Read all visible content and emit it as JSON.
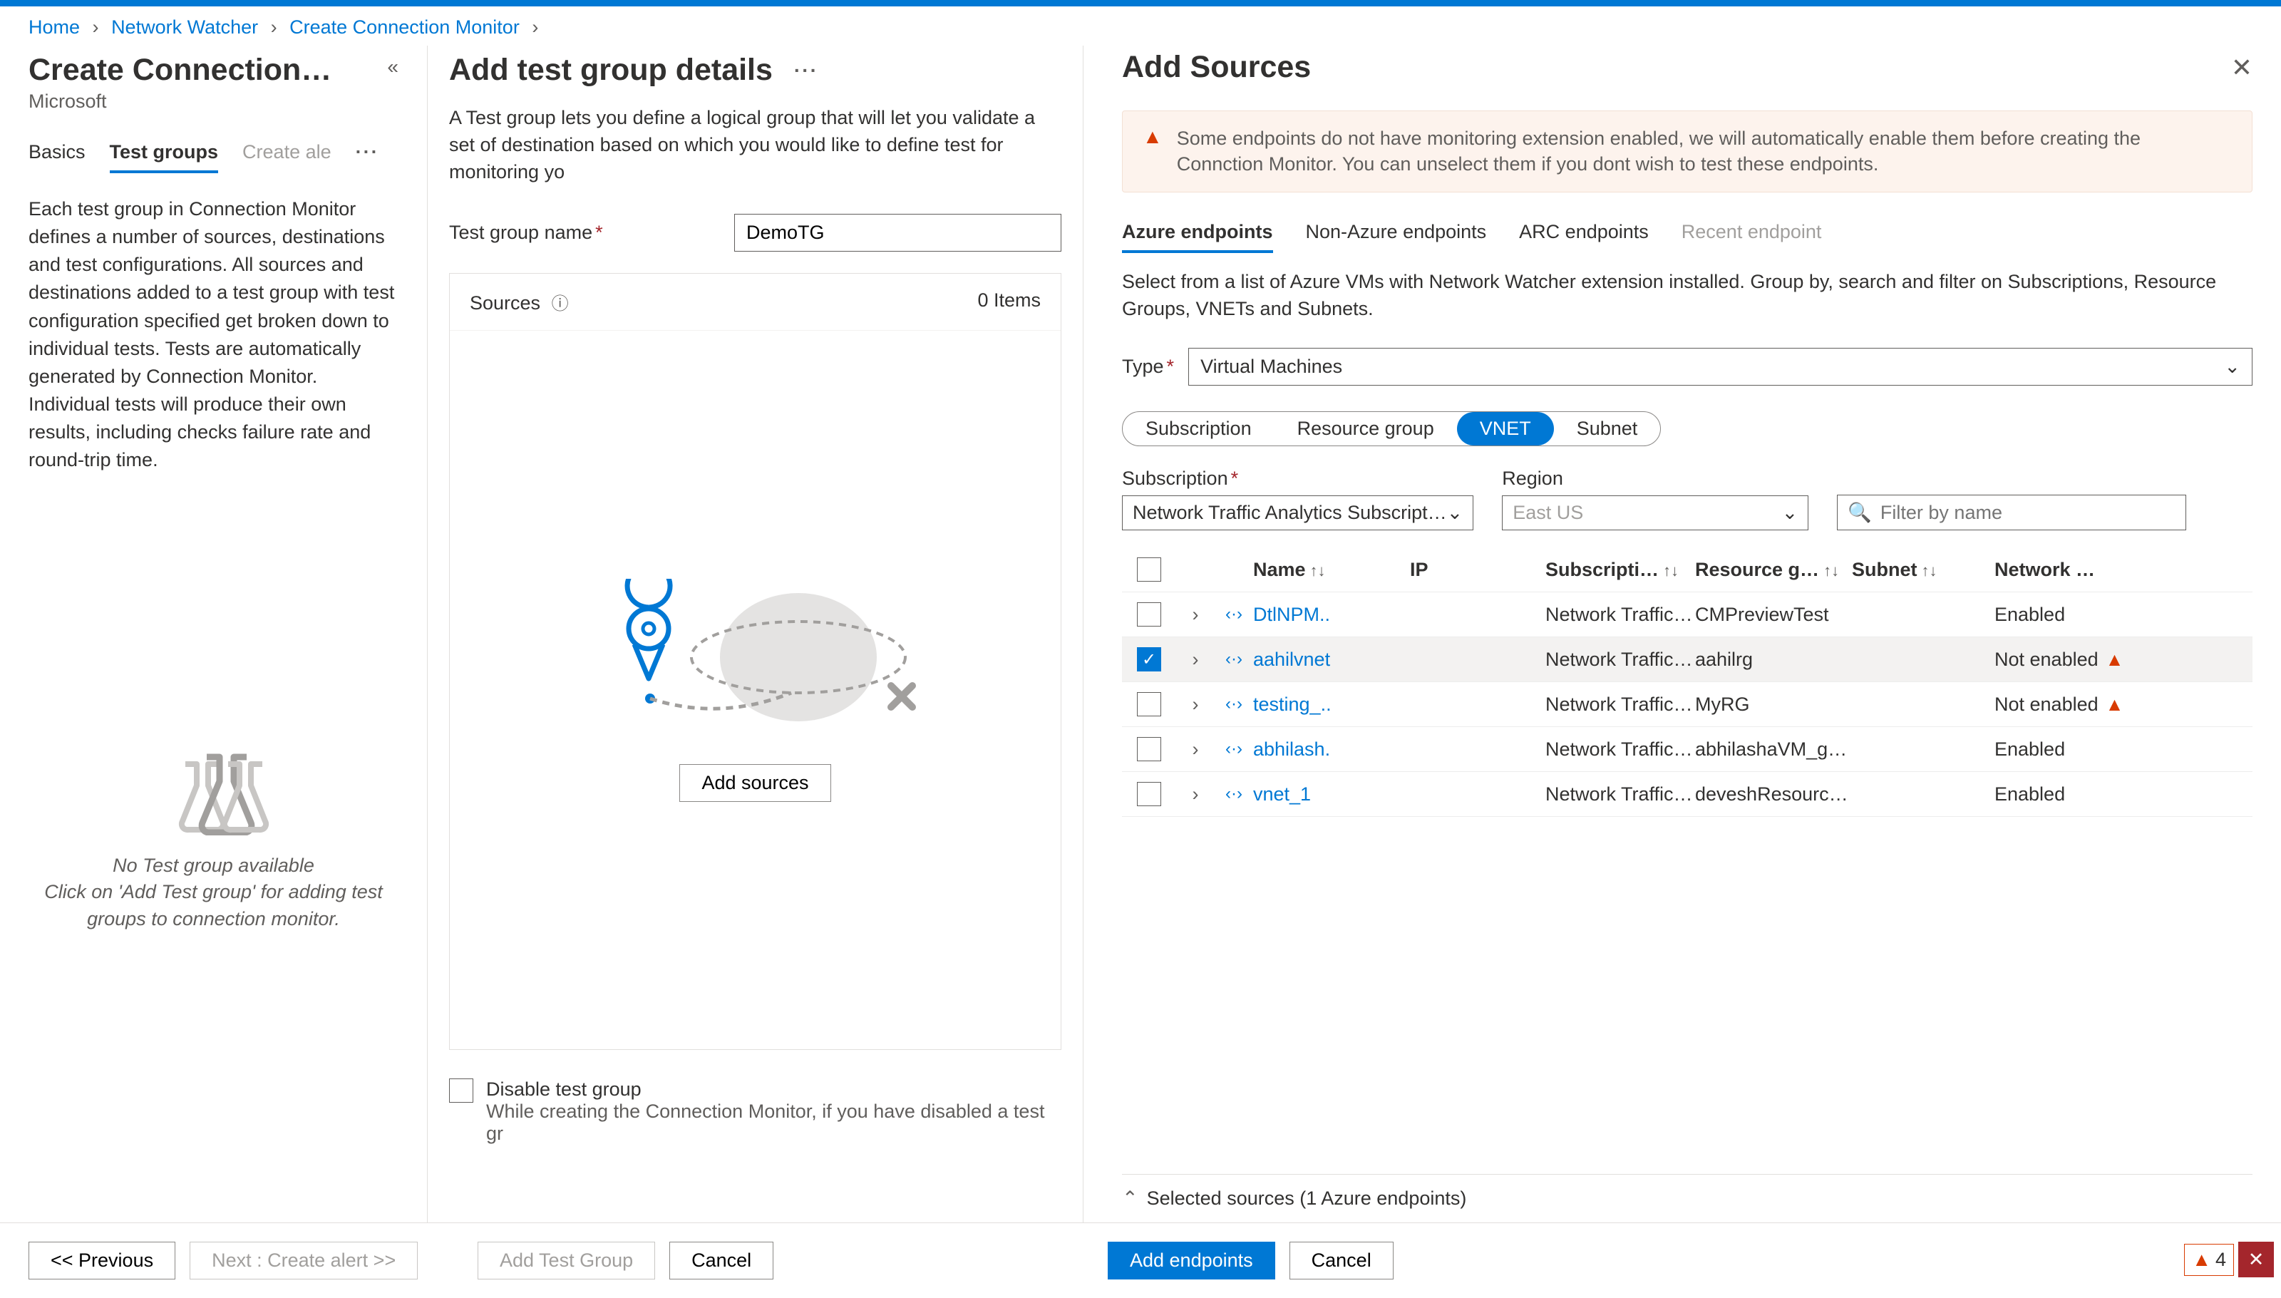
{
  "breadcrumb": [
    "Home",
    "Network Watcher",
    "Create Connection Monitor"
  ],
  "left": {
    "title": "Create Connection…",
    "subtitle": "Microsoft",
    "tabs": [
      "Basics",
      "Test groups",
      "Create ale"
    ],
    "desc": "Each test group in Connection Monitor defines a number of sources, destinations and test configurations. All sources and destinations added to a test group with test configuration specified get broken down to individual tests. Tests are automatically generated by Connection Monitor. Individual tests will produce their own results, including checks failure rate and round-trip time.",
    "empty_title": "No Test group available",
    "empty_sub": "Click on 'Add Test group' for adding test groups to connection monitor."
  },
  "mid": {
    "title": "Add test group details",
    "desc": "A Test group lets you define a logical group that will let you validate a set of destination based on which you would like to define test for monitoring yo",
    "tg_label": "Test group name",
    "tg_value": "DemoTG",
    "sources_label": "Sources",
    "sources_count": "0 Items",
    "add_sources_btn": "Add sources",
    "disable_label": "Disable test group",
    "disable_sub": "While creating the Connection Monitor, if you have disabled a test gr"
  },
  "right": {
    "title": "Add Sources",
    "warn": "Some endpoints do not have monitoring extension enabled, we will automatically enable them before creating the Connction Monitor. You can unselect them if you dont wish to test these endpoints.",
    "ep_tabs": [
      "Azure endpoints",
      "Non-Azure endpoints",
      "ARC endpoints",
      "Recent endpoint"
    ],
    "ep_desc": "Select from a list of Azure VMs with Network Watcher extension installed. Group by, search and filter on Subscriptions, Resource Groups, VNETs and Subnets.",
    "type_label": "Type",
    "type_value": "Virtual Machines",
    "pills": [
      "Subscription",
      "Resource group",
      "VNET",
      "Subnet"
    ],
    "pill_active": 2,
    "sub_label": "Subscription",
    "sub_value": "Network Traffic Analytics Subscript…",
    "region_label": "Region",
    "region_value": "East US",
    "filter_placeholder": "Filter by name",
    "cols": {
      "name": "Name",
      "ip": "IP",
      "sub": "Subscripti…",
      "rg": "Resource g…",
      "subnet": "Subnet",
      "nw": "Network …"
    },
    "rows": [
      {
        "checked": false,
        "name": "DtlNPM..",
        "sub": "Network Traffic…",
        "rg": "CMPreviewTest",
        "subnet": "",
        "nw": "Enabled",
        "warn": false
      },
      {
        "checked": true,
        "name": "aahilvnet",
        "sub": "Network Traffic…",
        "rg": "aahilrg",
        "subnet": "",
        "nw": "Not enabled",
        "warn": true
      },
      {
        "checked": false,
        "name": "testing_..",
        "sub": "Network Traffic…",
        "rg": "MyRG",
        "subnet": "",
        "nw": "Not enabled",
        "warn": true
      },
      {
        "checked": false,
        "name": "abhilash.",
        "sub": "Network Traffic…",
        "rg": "abhilashaVM_g…",
        "subnet": "",
        "nw": "Enabled",
        "warn": false
      },
      {
        "checked": false,
        "name": "vnet_1",
        "sub": "Network Traffic…",
        "rg": "deveshResourc…",
        "subnet": "",
        "nw": "Enabled",
        "warn": false
      }
    ],
    "selected_bar": "Selected sources (1 Azure endpoints)",
    "add_btn": "Add endpoints",
    "cancel_btn": "Cancel"
  },
  "footer": {
    "prev": "<<  Previous",
    "next": "Next : Create alert >>",
    "add_tg": "Add Test Group",
    "cancel": "Cancel",
    "warn_count": "4"
  }
}
